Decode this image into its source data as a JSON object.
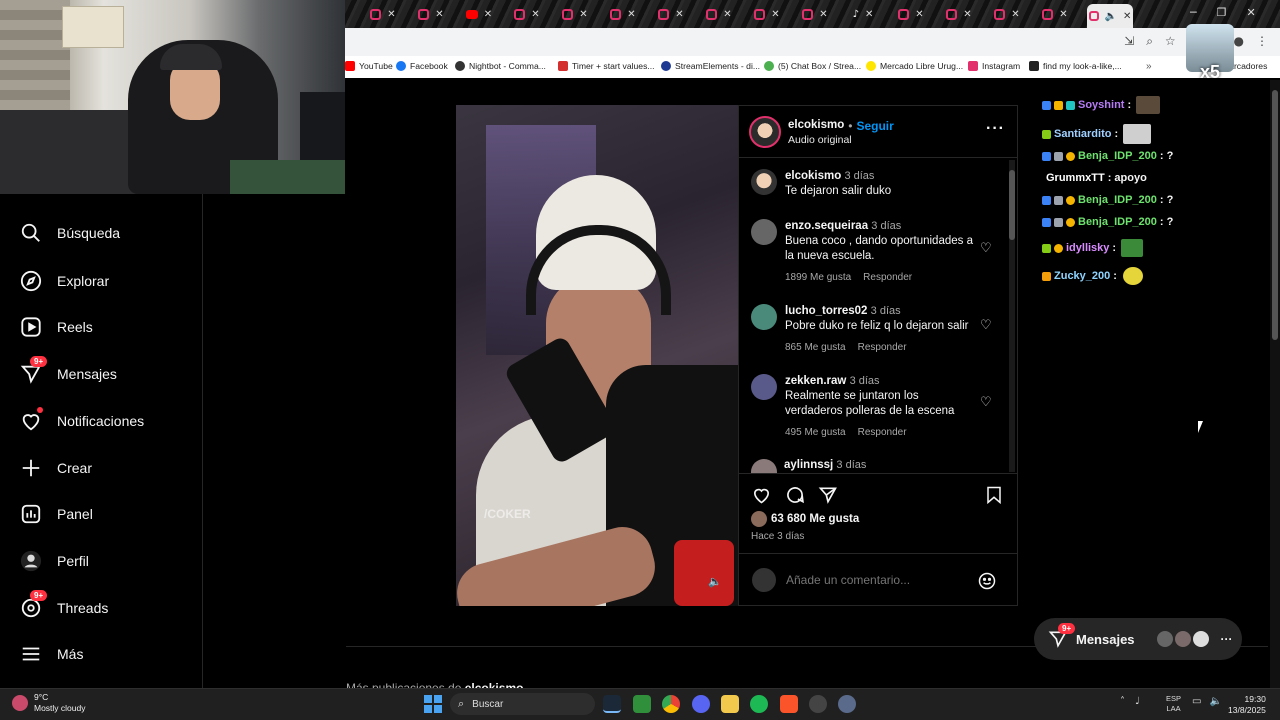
{
  "bookmarks": [
    {
      "label": "YouTube",
      "color": "#ff0000"
    },
    {
      "label": "Facebook",
      "color": "#1877f2"
    },
    {
      "label": "Nightbot - Comma...",
      "color": "#333333"
    },
    {
      "label": "Timer + start values...",
      "color": "#d32f2f"
    },
    {
      "label": "StreamElements - di...",
      "color": "#1f3a93"
    },
    {
      "label": "(5) Chat Box / Strea...",
      "color": "#4caf50"
    },
    {
      "label": "Mercado Libre Urug...",
      "color": "#ffe600"
    },
    {
      "label": "Instagram",
      "color": "#e1306c"
    },
    {
      "label": "find my look-a-like,...",
      "color": "#222222"
    }
  ],
  "bookmarks_end": "marcadores",
  "overlay_multiplier": "x5",
  "nav": {
    "search": "Búsqueda",
    "explore": "Explorar",
    "reels": "Reels",
    "messages": "Mensajes",
    "messages_badge": "9+",
    "notifications": "Notificaciones",
    "create": "Crear",
    "panel": "Panel",
    "profile": "Perfil",
    "threads": "Threads",
    "threads_badge": "9+",
    "more": "Más"
  },
  "post": {
    "author": "elcokismo",
    "follow": "Seguir",
    "follow_sep": "•",
    "audio": "Audio original",
    "watermark": "/COKER",
    "caption_user": "elcokismo",
    "caption_time": "3 días",
    "caption_text": "Te dejaron salir duko",
    "comments": [
      {
        "user": "enzo.sequeiraa",
        "time": "3 días",
        "text": "Buena coco , dando oportunidades a la nueva escuela.",
        "likes": "1899 Me gusta",
        "reply": "Responder"
      },
      {
        "user": "lucho_torres02",
        "time": "3 días",
        "text": "Pobre duko re feliz q lo dejaron salir",
        "likes": "865 Me gusta",
        "reply": "Responder"
      },
      {
        "user": "zekken.raw",
        "time": "3 días",
        "text": "Realmente se juntaron los verdaderos polleras de la escena",
        "likes": "495 Me gusta",
        "reply": "Responder"
      },
      {
        "user": "aylinnssj",
        "time": "3 días",
        "text": "",
        "likes": "",
        "reply": ""
      }
    ],
    "likes": "63 680 Me gusta",
    "posted": "Hace 3 días",
    "add_comment_placeholder": "Añade un comentario..."
  },
  "more_posts_label": "Más publicaciones de",
  "more_posts_user": "elcokismo",
  "chat": [
    {
      "user": "Soyshint",
      "color": "#b57cf6",
      "msg": ":"
    },
    {
      "user": "Santiardito",
      "color": "#9fd0ff",
      "msg": ":"
    },
    {
      "user": "Benja_IDP_200",
      "color": "#6ee26e",
      "msg": ": ?"
    },
    {
      "user": "GrummxTT",
      "color": "#ffffff",
      "msg": ": apoyo"
    },
    {
      "user": "Benja_IDP_200",
      "color": "#6ee26e",
      "msg": ": ?"
    },
    {
      "user": "Benja_IDP_200",
      "color": "#6ee26e",
      "msg": ": ?"
    },
    {
      "user": "idyllisky",
      "color": "#d98cff",
      "msg": ":"
    },
    {
      "user": "Zucky_200",
      "color": "#8fd4ff",
      "msg": ":"
    }
  ],
  "messages_pill": {
    "label": "Mensajes",
    "badge": "9+"
  },
  "taskbar": {
    "weather_temp": "9°C",
    "weather_desc": "Mostly cloudy",
    "search": "Buscar",
    "lang1": "ESP",
    "lang2": "LAA",
    "time": "19:30",
    "date": "13/8/2025"
  },
  "colors": {
    "accent": "#0095f6",
    "badge": "#ff3040",
    "instagram": "#e1306c"
  }
}
